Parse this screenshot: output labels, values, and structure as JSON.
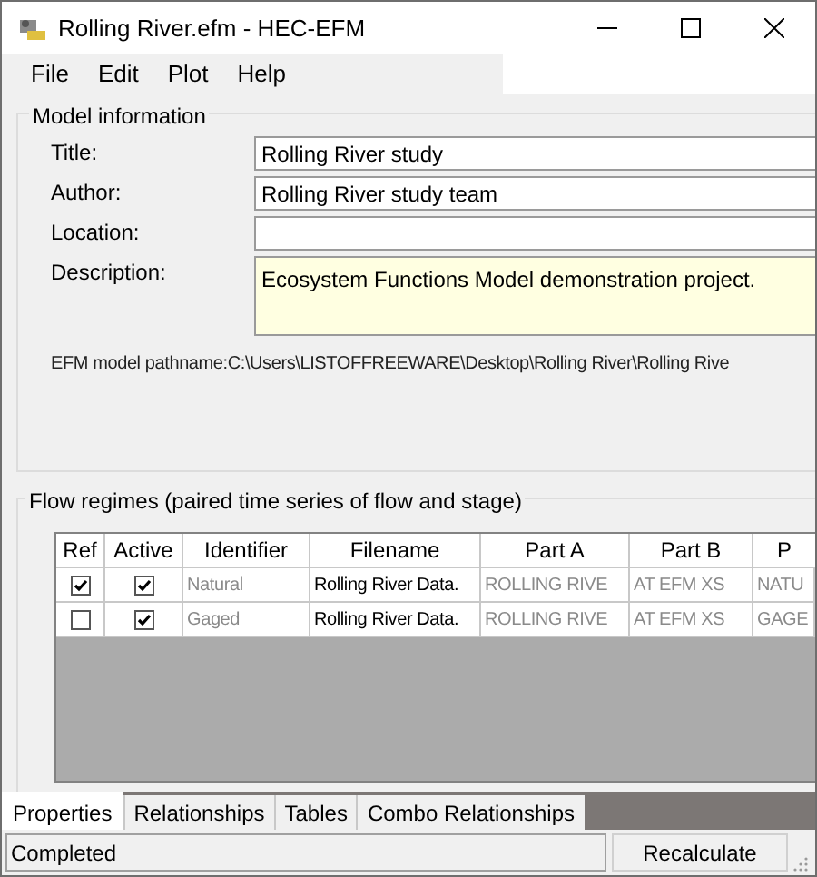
{
  "window": {
    "title": "Rolling River.efm - HEC-EFM"
  },
  "menu": [
    "File",
    "Edit",
    "Plot",
    "Help"
  ],
  "model_information": {
    "title": "Model information",
    "fields": [
      {
        "label": "Title:",
        "value": "Rolling River study",
        "kind": "text"
      },
      {
        "label": "Author:",
        "value": "Rolling River study team",
        "kind": "text"
      },
      {
        "label": "Location:",
        "kind": "text"
      },
      {
        "label": "Description:",
        "value": "Ecosystem Functions Model demonstration project.",
        "kind": "textarea"
      }
    ],
    "pathname": "EFM model pathname:C:\\Users\\LISTOFFREEWARE\\Desktop\\Rolling River\\Rolling Rive"
  },
  "flow_regimes": {
    "title": "Flow regimes (paired time series of flow and stage)",
    "columns": [
      "Ref",
      "Active",
      "Identifier",
      "Filename",
      "Part A",
      "Part B",
      "P"
    ],
    "rows": [
      {
        "ref": true,
        "active": true,
        "identifier": "Natural",
        "filename": "Rolling River Data.",
        "part_a": "ROLLING RIVE",
        "part_b": "AT EFM XS",
        "column_7": "NATU"
      },
      {
        "ref": false,
        "active": true,
        "identifier": "Gaged",
        "filename": "Rolling River Data.",
        "part_a": "ROLLING RIVE",
        "part_b": "AT EFM XS",
        "column_7": "GAGE"
      }
    ]
  },
  "tabs": [
    {
      "label": "Properties",
      "selected": true
    },
    {
      "label": "Relationships",
      "selected": false
    },
    {
      "label": "Tables",
      "selected": false
    },
    {
      "label": "Combo Relationships",
      "selected": false
    }
  ],
  "status_bar": {
    "status": "Completed",
    "button": "Recalculate"
  }
}
